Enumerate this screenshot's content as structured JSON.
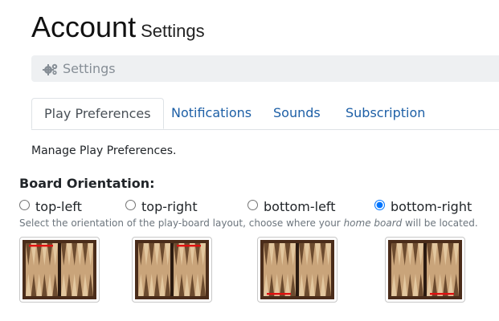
{
  "header": {
    "title": "Account",
    "subtitle": "Settings"
  },
  "breadcrumb": {
    "icon": "gears-icon",
    "label": "Settings"
  },
  "tabs": [
    {
      "label": "Play Preferences",
      "active": true
    },
    {
      "label": "Notifications",
      "active": false
    },
    {
      "label": "Sounds",
      "active": false
    },
    {
      "label": "Subscription",
      "active": false
    }
  ],
  "description": "Manage Play Preferences.",
  "orientation": {
    "heading": "Board Orientation:",
    "options": [
      {
        "label": "top-left",
        "checked": false
      },
      {
        "label": "top-right",
        "checked": false
      },
      {
        "label": "bottom-left",
        "checked": false
      },
      {
        "label": "bottom-right",
        "checked": true
      }
    ],
    "help_before": "Select the orientation of the play-board layout, choose where your ",
    "help_em": "home board",
    "help_after": " will be located."
  },
  "colors": {
    "link": "#1d5fa6",
    "board_frame": "#4a2c1a",
    "board_bar": "#2b1a10",
    "marker": "#e01010"
  }
}
